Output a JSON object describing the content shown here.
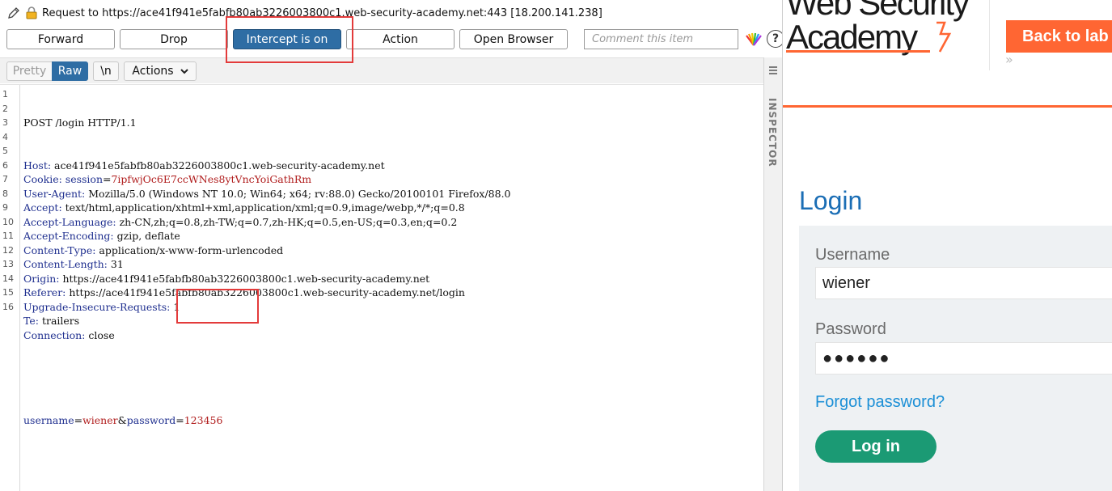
{
  "burp": {
    "request_line": "Request to https://ace41f941e5fabfb80ab3226003800c1.web-security-academy.net:443  [18.200.141.238]",
    "buttons": {
      "forward": "Forward",
      "drop": "Drop",
      "intercept": "Intercept is on",
      "action": "Action",
      "open_browser": "Open Browser"
    },
    "comment_placeholder": "Comment this item",
    "help_label": "?",
    "editor_toolbar": {
      "pretty": "Pretty",
      "raw": "Raw",
      "newline": "\\n",
      "actions": "Actions"
    },
    "inspector_label": "INSPECTOR",
    "request": {
      "line_numbers": [
        "1",
        "2",
        "3",
        "4",
        "5",
        "6",
        "7",
        "8",
        "9",
        "10",
        "11",
        "12",
        "13",
        "14",
        "15",
        "16"
      ],
      "start_line": "POST /login HTTP/1.1",
      "headers": [
        {
          "name": "Host:",
          "value": " ace41f941e5fabfb80ab3226003800c1.web-security-academy.net"
        },
        {
          "name": "Cookie:",
          "value": " ",
          "cookie_name": "session",
          "cookie_eq": "=",
          "cookie_value": "7ipfwjOc6E7ccWNes8ytVncYoiGathRm"
        },
        {
          "name": "User-Agent:",
          "value": " Mozilla/5.0 (Windows NT 10.0; Win64; x64; rv:88.0) Gecko/20100101 Firefox/88.0"
        },
        {
          "name": "Accept:",
          "value": " text/html,application/xhtml+xml,application/xml;q=0.9,image/webp,*/*;q=0.8"
        },
        {
          "name": "Accept-Language:",
          "value": " zh-CN,zh;q=0.8,zh-TW;q=0.7,zh-HK;q=0.5,en-US;q=0.3,en;q=0.2"
        },
        {
          "name": "Accept-Encoding:",
          "value": " gzip, deflate"
        },
        {
          "name": "Content-Type:",
          "value": " application/x-www-form-urlencoded"
        },
        {
          "name": "Content-Length:",
          "value": " 31"
        },
        {
          "name": "Origin:",
          "value": " https://ace41f941e5fabfb80ab3226003800c1.web-security-academy.net"
        },
        {
          "name": "Referer:",
          "value": " https://ace41f941e5fabfb80ab3226003800c1.web-security-academy.net/login"
        },
        {
          "name": "Upgrade-Insecure-Requests:",
          "value": " 1"
        },
        {
          "name": "Te:",
          "value": " trailers"
        },
        {
          "name": "Connection:",
          "value": " close"
        }
      ],
      "body": {
        "k1": "username",
        "eq1": "=",
        "v1": "wiener",
        "amp": "&",
        "k2": "password",
        "eq2": "=",
        "v2": "123456"
      }
    }
  },
  "academy": {
    "logo_line1": "Web Security",
    "logo_line2": "Academy",
    "back_to_lab": "Back to lab",
    "chevron": "»",
    "page_title": "Login",
    "username_label": "Username",
    "username_value": "wiener",
    "password_label": "Password",
    "password_value": "●●●●●●",
    "forgot_password": "Forgot password?",
    "login_button": "Log in"
  },
  "colors": {
    "burp_accent": "#2e6da4",
    "highlight_box": "#e33b3b",
    "academy_orange": "#ff6633",
    "academy_blue": "#1b6eb5",
    "login_green": "#1b9a74",
    "header_key": "#1f2f8f",
    "cookie_value": "#b01c1c"
  }
}
